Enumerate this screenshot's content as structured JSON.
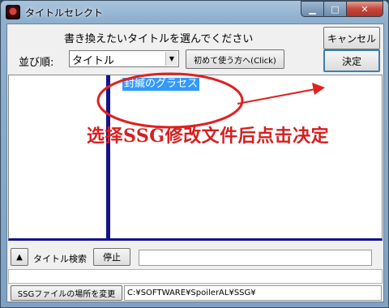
{
  "window": {
    "title": "タイトルセレクト"
  },
  "header": {
    "prompt": "書き換えたいタイトルを選んでください",
    "sort_label": "並び順:",
    "sort_value": "タイトル",
    "howto_label": "初めて使う方へ(Click)",
    "cancel_label": "キャンセル",
    "ok_label": "決定"
  },
  "list": {
    "items": [
      {
        "label": "封緘のグラセス"
      }
    ]
  },
  "annotation": {
    "text": "选择SSG修改文件后点击决定",
    "color": "#d61f1f"
  },
  "search": {
    "up_label": "▲",
    "label": "タイトル検索",
    "stop_label": "停止",
    "value": ""
  },
  "footer": {
    "ssg_button_label": "SSGファイルの場所を変更",
    "path": "C:¥SOFTWARE¥SpoilerAL¥SSG¥"
  },
  "icons": {
    "app": "app-icon",
    "combo": "chevron-down-icon",
    "up": "up-arrow-icon"
  }
}
